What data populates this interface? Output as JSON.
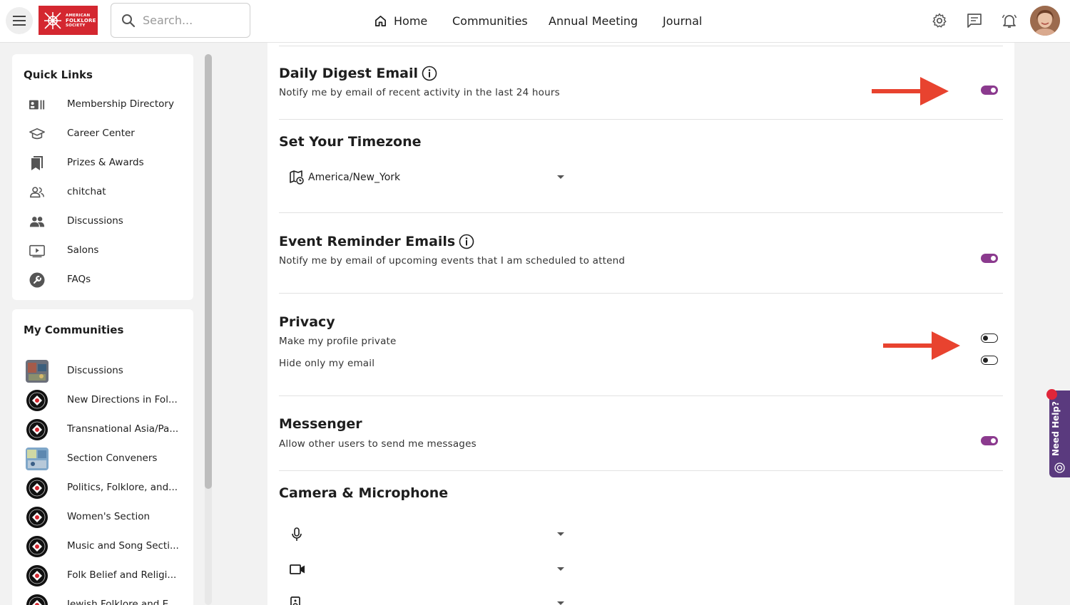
{
  "topbar": {
    "logo_text": [
      "AMERICAN",
      "FOLKLORE",
      "SOCIETY"
    ],
    "search_placeholder": "Search...",
    "nav": [
      {
        "label": "Home",
        "icon": "home-icon"
      },
      {
        "label": "Communities"
      },
      {
        "label": "Annual Meeting"
      },
      {
        "label": "Journal"
      }
    ],
    "icons": [
      "menu-icon",
      "gear-icon",
      "chat-icon",
      "bell-icon",
      "avatar"
    ]
  },
  "quick_links": {
    "title": "Quick Links",
    "items": [
      {
        "label": "Membership Directory",
        "icon": "directory-icon"
      },
      {
        "label": "Career Center",
        "icon": "graduation-cap-icon"
      },
      {
        "label": "Prizes & Awards",
        "icon": "bookmark-icon"
      },
      {
        "label": "chitchat",
        "icon": "people-outline-icon"
      },
      {
        "label": "Discussions",
        "icon": "people-icon"
      },
      {
        "label": "Salons",
        "icon": "video-play-icon"
      },
      {
        "label": "FAQs",
        "icon": "wrench-icon"
      }
    ]
  },
  "my_communities": {
    "title": "My Communities",
    "items": [
      {
        "label": "Discussions",
        "thumb": "photo"
      },
      {
        "label": "New Directions in Fol...",
        "thumb": "emblem"
      },
      {
        "label": "Transnational Asia/Pa...",
        "thumb": "emblem"
      },
      {
        "label": "Section Conveners",
        "thumb": "photo"
      },
      {
        "label": "Politics, Folklore, and...",
        "thumb": "emblem"
      },
      {
        "label": "Women's Section",
        "thumb": "emblem"
      },
      {
        "label": "Music and Song Secti...",
        "thumb": "emblem"
      },
      {
        "label": "Folk Belief and Religi...",
        "thumb": "emblem"
      },
      {
        "label": "Jewish Folklore and E...",
        "thumb": "emblem"
      }
    ]
  },
  "settings": {
    "daily_digest": {
      "title": "Daily Digest Email",
      "desc": "Notify me by email of recent activity in the last 24 hours",
      "enabled": true
    },
    "timezone": {
      "title": "Set Your Timezone",
      "value": "America/New_York"
    },
    "event_reminder": {
      "title": "Event Reminder Emails",
      "desc": "Notify me by email of upcoming events that I am scheduled to attend",
      "enabled": true
    },
    "privacy": {
      "title": "Privacy",
      "private_profile_label": "Make my profile private",
      "private_profile_enabled": false,
      "hide_email_label": "Hide only my email",
      "hide_email_enabled": false
    },
    "messenger": {
      "title": "Messenger",
      "desc": "Allow other users to send me messages",
      "enabled": true
    },
    "camera_mic": {
      "title": "Camera & Microphone",
      "devices": [
        {
          "icon": "microphone-icon",
          "value": ""
        },
        {
          "icon": "camera-icon",
          "value": ""
        },
        {
          "icon": "speaker-icon",
          "value": ""
        }
      ]
    }
  },
  "help_tab": {
    "label": "Need Help?"
  },
  "colors": {
    "accent": "#8b3a8e",
    "logo_red": "#d42730",
    "annotation_arrow": "#e8432f",
    "help_tab": "#5a3a7e"
  }
}
